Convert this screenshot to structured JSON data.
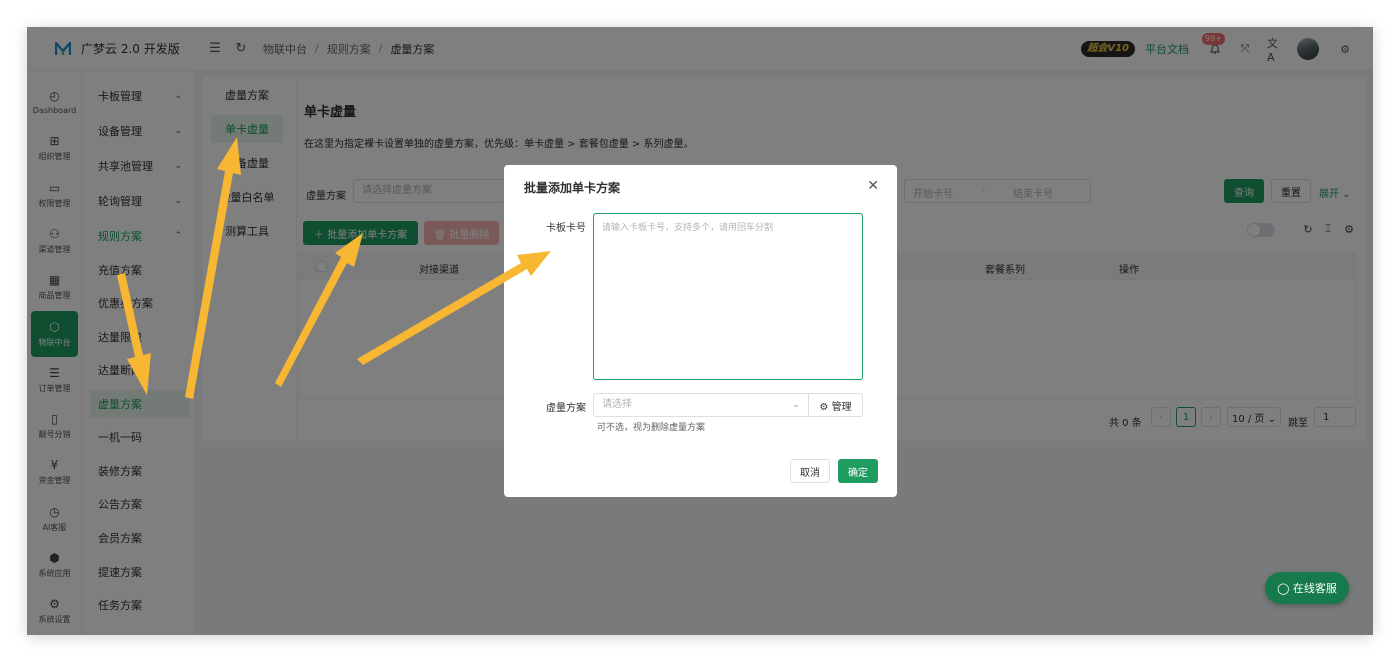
{
  "app": {
    "title": "广梦云 2.0 开发版"
  },
  "breadcrumb": [
    "物联中台",
    "规则方案",
    "虚量方案"
  ],
  "topbar": {
    "vip": "超会V10",
    "docs": "平台文档",
    "notify_count": "99+",
    "lang": "文A"
  },
  "rail": [
    {
      "label": "Dashboard",
      "icon": "dashboard-icon",
      "glyph": "◴"
    },
    {
      "label": "组织管理",
      "icon": "org-icon",
      "glyph": "⊞"
    },
    {
      "label": "权限管理",
      "icon": "monitor-icon",
      "glyph": "▭"
    },
    {
      "label": "渠道管理",
      "icon": "channel-icon",
      "glyph": "⚇"
    },
    {
      "label": "商品管理",
      "icon": "shop-icon",
      "glyph": "▦"
    },
    {
      "label": "物联中台",
      "icon": "cube-icon",
      "glyph": "⬡"
    },
    {
      "label": "订单管理",
      "icon": "list-icon",
      "glyph": "☰"
    },
    {
      "label": "靓号分销",
      "icon": "phone-icon",
      "glyph": "▯"
    },
    {
      "label": "资金管理",
      "icon": "yen-icon",
      "glyph": "¥"
    },
    {
      "label": "AI客服",
      "icon": "timer-icon",
      "glyph": "◷"
    },
    {
      "label": "系统应用",
      "icon": "app-icon",
      "glyph": "⬢"
    },
    {
      "label": "系统设置",
      "icon": "settings-icon",
      "glyph": "⚙"
    }
  ],
  "subnav": [
    {
      "label": "卡板管理",
      "chev": "⌄"
    },
    {
      "label": "设备管理",
      "chev": "⌄"
    },
    {
      "label": "共享池管理",
      "chev": "⌄"
    },
    {
      "label": "轮询管理",
      "chev": "⌄"
    },
    {
      "label": "规则方案",
      "chev": "⌃"
    },
    {
      "label": "充值方案"
    },
    {
      "label": "优惠券方案"
    },
    {
      "label": "达量限速"
    },
    {
      "label": "达量断网"
    },
    {
      "label": "虚量方案"
    },
    {
      "label": "一机一码"
    },
    {
      "label": "装修方案"
    },
    {
      "label": "公告方案"
    },
    {
      "label": "会员方案"
    },
    {
      "label": "提速方案"
    },
    {
      "label": "任务方案"
    }
  ],
  "tabs": [
    "虚量方案",
    "单卡虚量",
    "设备虚量",
    "虚量白名单",
    "测算工具"
  ],
  "section": {
    "title": "单卡虚量",
    "desc": "在这里为指定裸卡设置单独的虚量方案，优先级：单卡虚量 > 套餐包虚量 > 系列虚量。"
  },
  "filter": {
    "label": "虚量方案",
    "placeholder": "请选择虚量方案",
    "start": "开始卡号",
    "dash": "-",
    "end": "结束卡号",
    "search": "查询",
    "reset": "重置",
    "expand": "展开 ⌄"
  },
  "actions": {
    "batch_add": "＋ 批量添加单卡方案",
    "batch_delete": "🗑 批量删除"
  },
  "table": {
    "columns": [
      "对接渠道",
      "套餐系列",
      "操作"
    ]
  },
  "pagination": {
    "total": "共 0 条",
    "page": "1",
    "size": "10 / 页 ⌄",
    "goto": "跳至",
    "goto_value": "1",
    "prev": "‹",
    "next": "›"
  },
  "dialog": {
    "title": "批量添加单卡方案",
    "card_label": "卡板卡号",
    "card_placeholder": "请输入卡板卡号，支持多个，请用回车分割",
    "plan_label": "虚量方案",
    "plan_placeholder": "请选择",
    "manage": "⚙ 管理",
    "hint": "可不选，视为删除虚量方案",
    "cancel": "取消",
    "confirm": "确定",
    "close": "✕"
  },
  "chat": {
    "label": "◯ 在线客服"
  },
  "colors": {
    "accent": "#1f9d60",
    "danger": "#f56c6c",
    "arrow": "#f7b733"
  }
}
